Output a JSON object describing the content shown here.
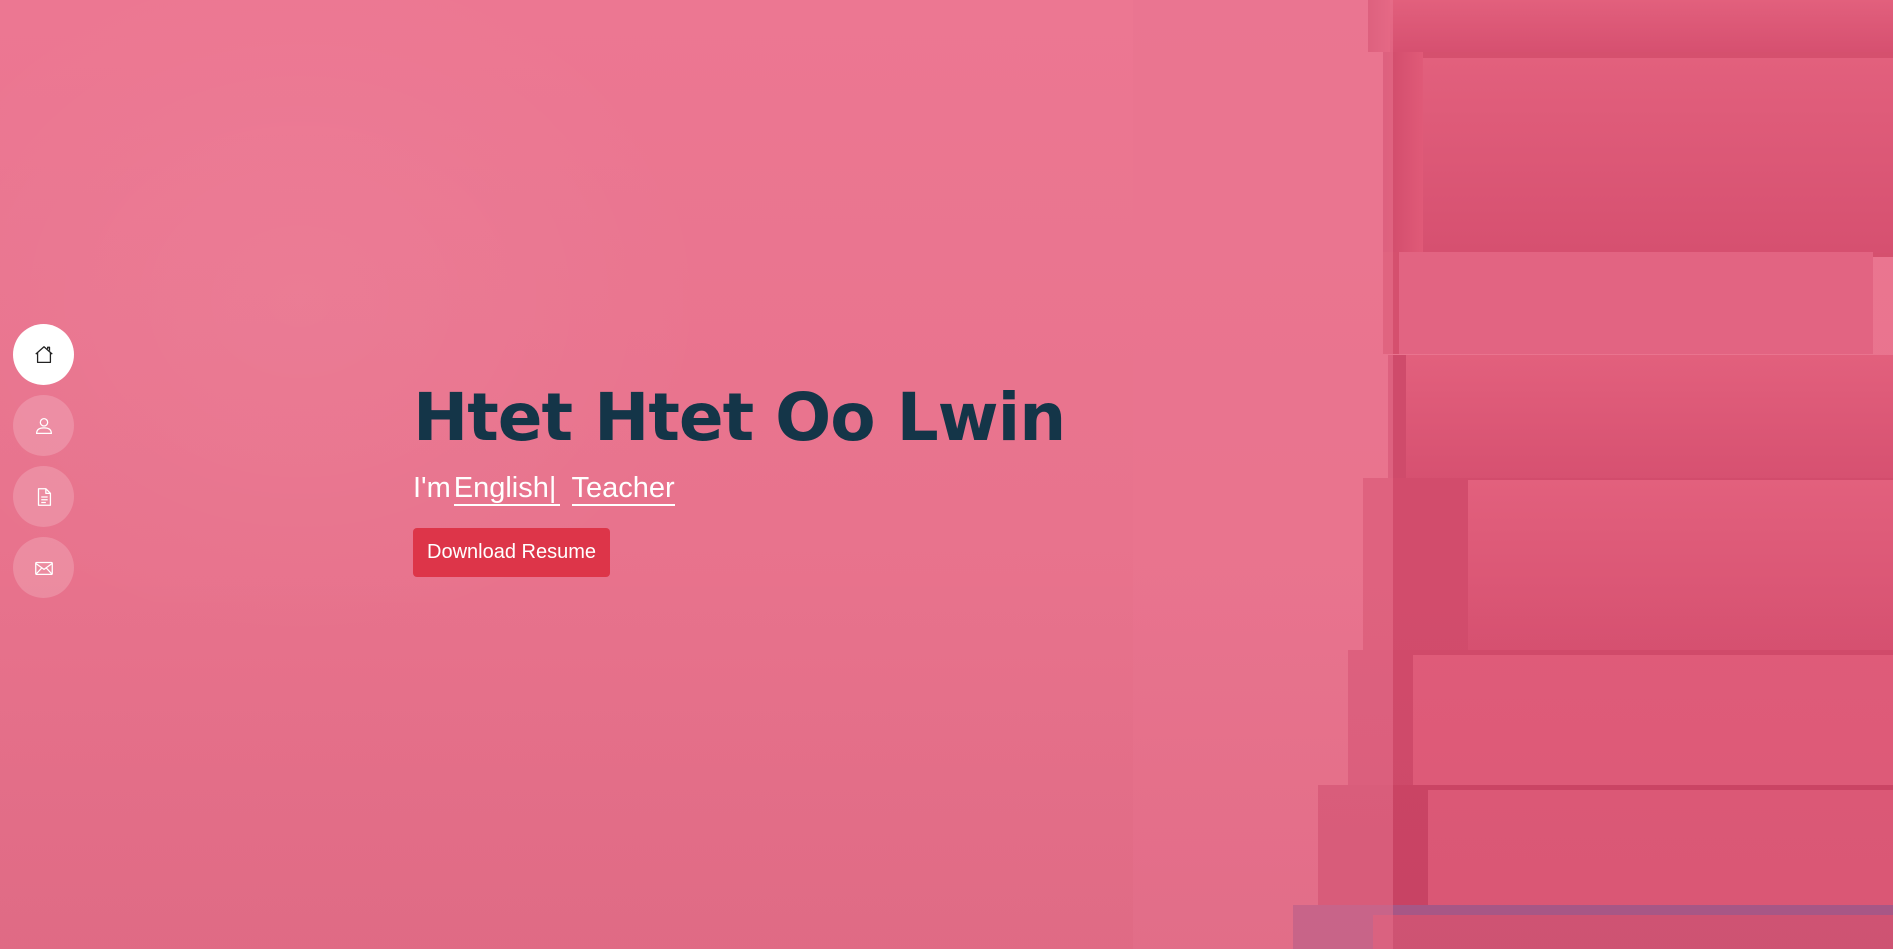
{
  "hero": {
    "name": "Htet Htet Oo Lwin",
    "prefix": "I'm",
    "typed_word_1": "English",
    "typed_cursor": "|",
    "typed_word_2": "Teacher",
    "download_label": "Download Resume"
  },
  "nav": {
    "items": [
      {
        "icon": "home-icon",
        "active": true
      },
      {
        "icon": "person-icon",
        "active": false
      },
      {
        "icon": "document-icon",
        "active": false
      },
      {
        "icon": "envelope-icon",
        "active": false
      }
    ]
  },
  "colors": {
    "overlay": "#e97590",
    "name_text": "#143548",
    "button": "#dd3549",
    "books": "#e05675"
  }
}
